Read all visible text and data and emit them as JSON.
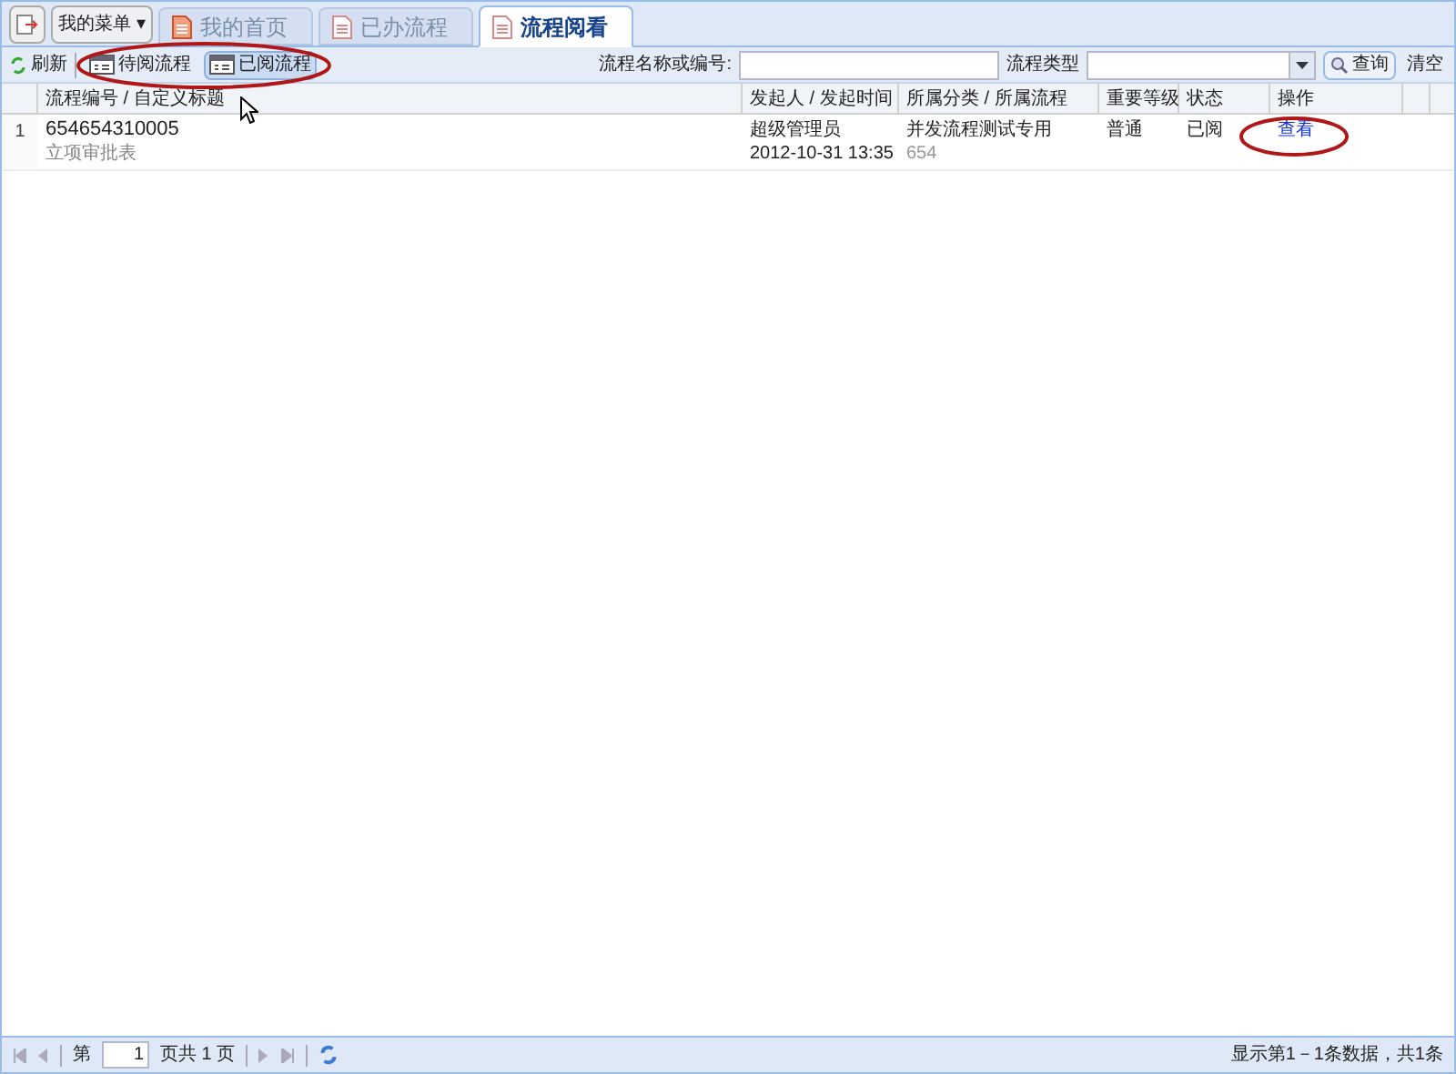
{
  "top_bar": {
    "menu_button": "我的菜单",
    "menu_caret": "▾",
    "tabs": [
      {
        "label": "我的首页",
        "selected": false
      },
      {
        "label": "已办流程",
        "selected": false
      },
      {
        "label": "流程阅看",
        "selected": true
      }
    ]
  },
  "toolbar": {
    "refresh": "刷新",
    "filters": [
      {
        "label": "待阅流程",
        "selected": false
      },
      {
        "label": "已阅流程",
        "selected": true
      }
    ],
    "name_label": "流程名称或编号:",
    "type_label": "流程类型",
    "search": "查询",
    "clear": "清空"
  },
  "table": {
    "columns": [
      "流程编号 / 自定义标题",
      "发起人 / 发起时间",
      "所属分类 / 所属流程",
      "重要等级",
      "状态",
      "操作"
    ],
    "rows": [
      {
        "index": "1",
        "number": "654654310005",
        "title": "立项审批表",
        "initiator": "超级管理员",
        "time": "2012-10-31 13:35",
        "category": "并发流程测试专用",
        "process": "654",
        "level": "普通",
        "status": "已阅",
        "action": "查看"
      }
    ]
  },
  "pager": {
    "page_prefix": "第",
    "page": "1",
    "page_suffix": "页共 1 页",
    "summary": "显示第1－1条数据，共1条"
  }
}
